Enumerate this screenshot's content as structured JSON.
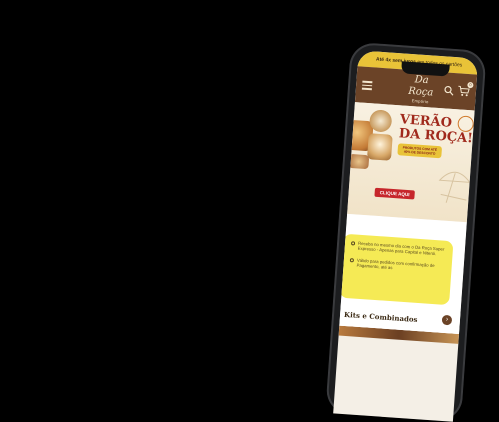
{
  "promo_bar": {
    "highlight": "Até 4x sem juros",
    "text": "em todos os cartões"
  },
  "header": {
    "menu_icon": "hamburger-menu-icon",
    "logo_line1": "Da Roça",
    "logo_line2": "Empório",
    "search_icon": "search-icon",
    "cart_icon": "shopping-cart-icon",
    "cart_count": "0"
  },
  "banner": {
    "title_line1": "VERÃO",
    "title_line2": "DA ROÇA!",
    "discount_line1": "PRODUTOS COM ATÉ",
    "discount_line2": "40% DE DESCONTO",
    "cta_label": "CLIQUE AQUI"
  },
  "info_card": {
    "item1": "Receba no mesmo dia com o Da Roça Super Expresso - Apenas para Capital e Niterói.",
    "item2": "Válido para pedidos com confirmação de Pagamento, até as"
  },
  "sections": {
    "kits_title": "Kits e Combinados"
  },
  "colors": {
    "brand_brown": "#6b4327",
    "promo_yellow": "#e9c338",
    "accent_red": "#c6262b",
    "cream": "#f4efe6"
  }
}
